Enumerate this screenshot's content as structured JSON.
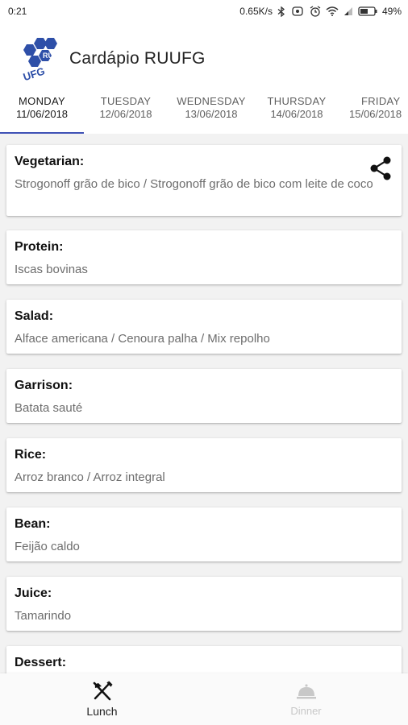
{
  "status_bar": {
    "time": "0:21",
    "network_speed": "0.65K/s",
    "battery": "49%"
  },
  "app": {
    "title": "Cardápio RUUFG",
    "logo_text_top": "RU",
    "logo_text_bottom": "UFG"
  },
  "tabs": [
    {
      "day": "MONDAY",
      "date": "11/06/2018",
      "selected": true
    },
    {
      "day": "TUESDAY",
      "date": "12/06/2018",
      "selected": false
    },
    {
      "day": "WEDNESDAY",
      "date": "13/06/2018",
      "selected": false
    },
    {
      "day": "THURSDAY",
      "date": "14/06/2018",
      "selected": false
    },
    {
      "day": "FRIDAY",
      "date": "15/06/2018",
      "selected": false
    }
  ],
  "menu": [
    {
      "title": "Vegetarian:",
      "body": "Strogonoff grão de bico / Strogonoff grão de bico com leite de coco"
    },
    {
      "title": "Protein:",
      "body": "Iscas bovinas"
    },
    {
      "title": "Salad:",
      "body": "Alface americana / Cenoura palha / Mix repolho"
    },
    {
      "title": "Garrison:",
      "body": "Batata sauté"
    },
    {
      "title": "Rice:",
      "body": "Arroz branco / Arroz integral"
    },
    {
      "title": "Bean:",
      "body": "Feijão caldo"
    },
    {
      "title": "Juice:",
      "body": "Tamarindo"
    },
    {
      "title": "Dessert:",
      "body": ""
    }
  ],
  "bottom_nav": {
    "lunch_label": "Lunch",
    "dinner_label": "Dinner"
  },
  "colors": {
    "accent": "#3f51b5",
    "logo_blue": "#2e4fa8"
  }
}
